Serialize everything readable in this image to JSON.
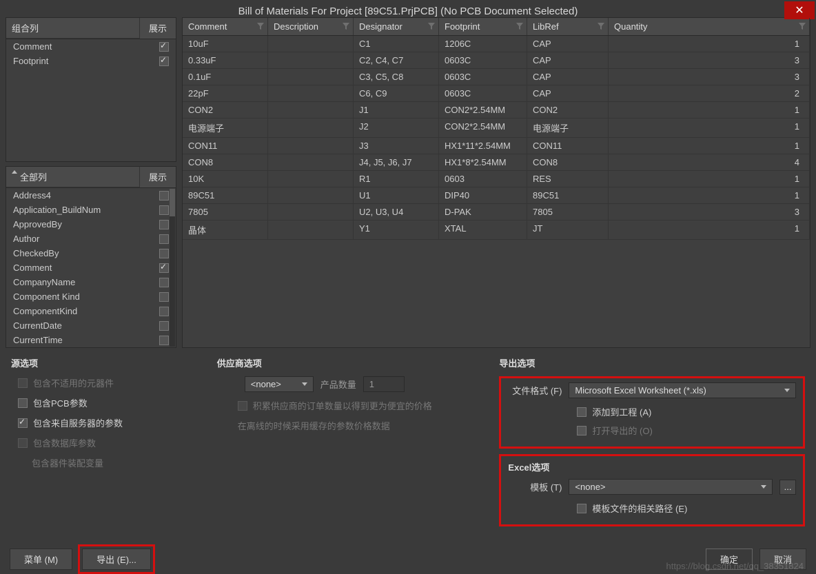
{
  "title": "Bill of Materials For Project [89C51.PrjPCB] (No PCB Document Selected)",
  "leftTop": {
    "header_col1": "组合列",
    "header_col2": "展示",
    "items": [
      {
        "label": "Comment",
        "checked": true
      },
      {
        "label": "Footprint",
        "checked": true
      }
    ]
  },
  "leftBottom": {
    "header_col1": "全部列",
    "header_col2": "展示",
    "items": [
      {
        "label": "Address4",
        "checked": false
      },
      {
        "label": "Application_BuildNum",
        "checked": false
      },
      {
        "label": "ApprovedBy",
        "checked": false
      },
      {
        "label": "Author",
        "checked": false
      },
      {
        "label": "CheckedBy",
        "checked": false
      },
      {
        "label": "Comment",
        "checked": true
      },
      {
        "label": "CompanyName",
        "checked": false
      },
      {
        "label": "Component Kind",
        "checked": false
      },
      {
        "label": "ComponentKind",
        "checked": false
      },
      {
        "label": "CurrentDate",
        "checked": false
      },
      {
        "label": "CurrentTime",
        "checked": false
      }
    ]
  },
  "grid": {
    "columns": [
      "Comment",
      "Description",
      "Designator",
      "Footprint",
      "LibRef",
      "Quantity"
    ],
    "rows": [
      {
        "comment": "10uF",
        "desc": "",
        "desig": "C1",
        "foot": "1206C",
        "lib": "CAP",
        "qty": "1"
      },
      {
        "comment": "0.33uF",
        "desc": "",
        "desig": "C2, C4, C7",
        "foot": "0603C",
        "lib": "CAP",
        "qty": "3"
      },
      {
        "comment": "0.1uF",
        "desc": "",
        "desig": "C3, C5, C8",
        "foot": "0603C",
        "lib": "CAP",
        "qty": "3"
      },
      {
        "comment": "22pF",
        "desc": "",
        "desig": "C6, C9",
        "foot": "0603C",
        "lib": "CAP",
        "qty": "2"
      },
      {
        "comment": "CON2",
        "desc": "",
        "desig": "J1",
        "foot": "CON2*2.54MM",
        "lib": "CON2",
        "qty": "1"
      },
      {
        "comment": "电源端子",
        "desc": "",
        "desig": "J2",
        "foot": "CON2*2.54MM",
        "lib": "电源端子",
        "qty": "1"
      },
      {
        "comment": "CON11",
        "desc": "",
        "desig": "J3",
        "foot": "HX1*11*2.54MM",
        "lib": "CON11",
        "qty": "1"
      },
      {
        "comment": "CON8",
        "desc": "",
        "desig": "J4, J5, J6, J7",
        "foot": "HX1*8*2.54MM",
        "lib": "CON8",
        "qty": "4"
      },
      {
        "comment": "10K",
        "desc": "",
        "desig": "R1",
        "foot": "0603",
        "lib": "RES",
        "qty": "1"
      },
      {
        "comment": "89C51",
        "desc": "",
        "desig": "U1",
        "foot": "DIP40",
        "lib": "89C51",
        "qty": "1"
      },
      {
        "comment": "7805",
        "desc": "",
        "desig": "U2, U3, U4",
        "foot": "D-PAK",
        "lib": "7805",
        "qty": "3"
      },
      {
        "comment": "晶体",
        "desc": "",
        "desig": "Y1",
        "foot": "XTAL",
        "lib": "JT",
        "qty": "1"
      }
    ]
  },
  "sourceOptions": {
    "title": "源选项",
    "opt1": "包含不适用的元器件",
    "opt2": "包含PCB参数",
    "opt3": "包含来自服务器的参数",
    "opt4": "包含数据库参数",
    "opt5": "包含器件装配变量"
  },
  "supplierOptions": {
    "title": "供应商选项",
    "dropdown": "<none>",
    "qtyLabel": "产品数量",
    "qtyValue": "1",
    "opt1": "积累供应商的订单数量以得到更为便宜的价格",
    "opt2": "在离线的时候采用缓存的参数价格数据"
  },
  "exportOptions": {
    "title": "导出选项",
    "formatLabel": "文件格式 (F)",
    "formatValue": "Microsoft Excel Worksheet (*.xls)",
    "addToProj": "添加到工程 (A)",
    "openExported": "打开导出的 (O)"
  },
  "excelOptions": {
    "title": "Excel选项",
    "templateLabel": "模板 (T)",
    "templateValue": "<none>",
    "relativePath": "模板文件的相关路径 (E)"
  },
  "footer": {
    "menu": "菜单 (M)",
    "export": "导出 (E)...",
    "ok": "确定",
    "cancel": "取消"
  },
  "watermark": "https://blog.csdn.net/qq_38351824"
}
